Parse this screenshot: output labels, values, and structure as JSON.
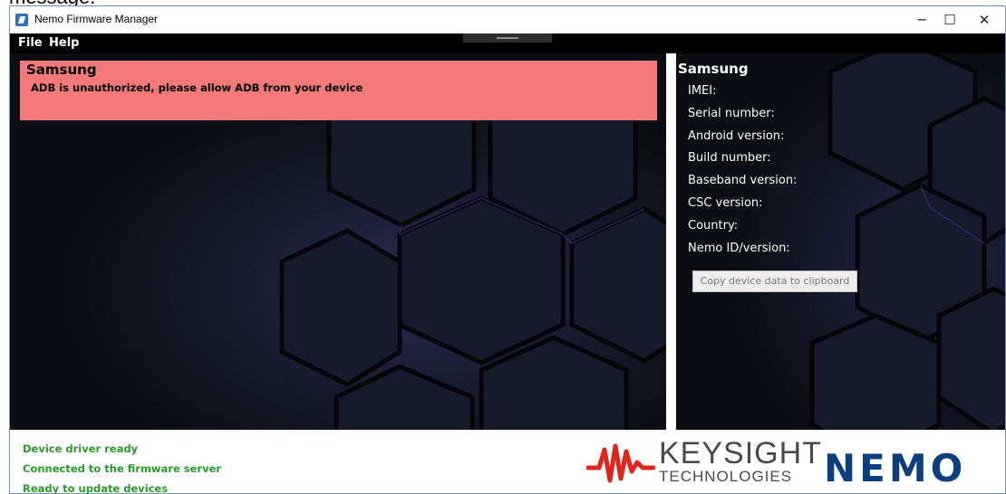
{
  "doc_fragment": "message.",
  "window": {
    "title": "Nemo Firmware Manager",
    "controls": {
      "minimize": "─",
      "maximize": "☐",
      "close": "✕"
    }
  },
  "menu": {
    "items": [
      {
        "label": "File"
      },
      {
        "label": "Help"
      }
    ]
  },
  "alert": {
    "title": "Samsung",
    "message": "ADB is unauthorized, please allow ADB from your device",
    "color": "#f47a7a"
  },
  "device_info": {
    "title": "Samsung",
    "fields": [
      "IMEI:",
      "Serial number:",
      "Android version:",
      "Build number:",
      "Baseband version:",
      "CSC version:",
      "Country:",
      "Nemo ID/version:"
    ],
    "copy_button": "Copy device data to clipboard"
  },
  "status": {
    "lines": [
      "Device driver ready",
      "Connected to the firmware server",
      "Ready to update devices"
    ],
    "color": "#2a9a2a"
  },
  "logos": {
    "keysight_main": "KEYSIGHT",
    "keysight_sub": "TECHNOLOGIES",
    "keysight_color": "#e1251b",
    "nemo": "NEMO",
    "nemo_color": "#0b3f7f"
  }
}
